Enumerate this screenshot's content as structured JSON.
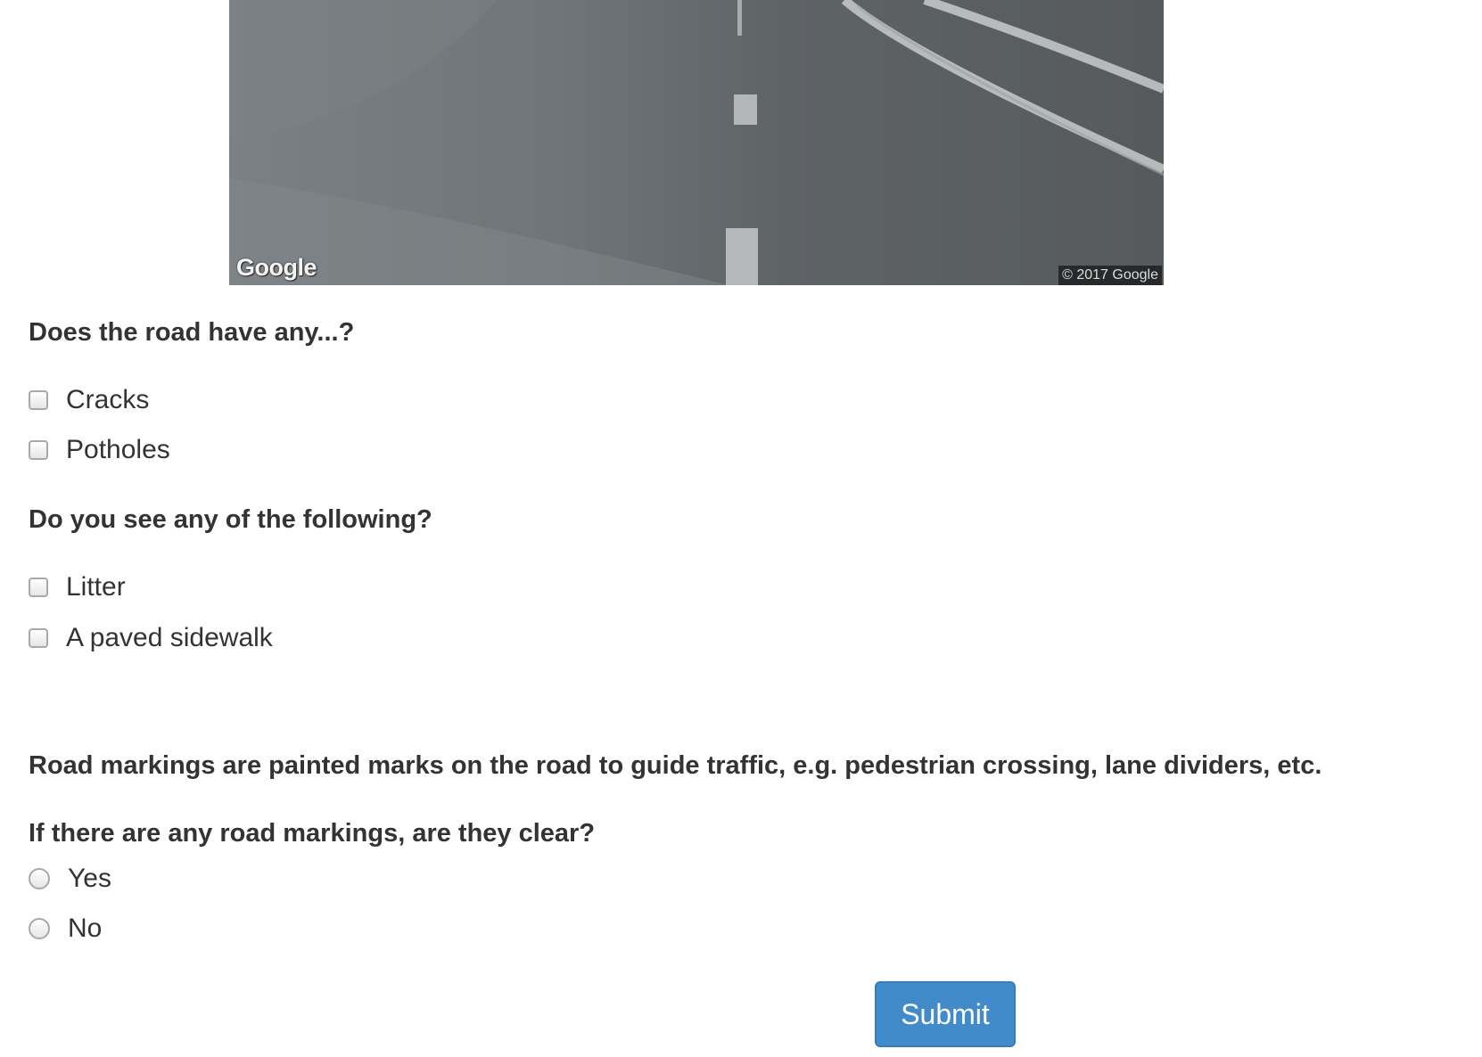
{
  "streetview": {
    "logo_text": "Google",
    "copyright": "© 2017 Google"
  },
  "section_road": {
    "question": "Does the road have any...?",
    "options": [
      "Cracks",
      "Potholes"
    ]
  },
  "section_see": {
    "question": "Do you see any of the following?",
    "options": [
      "Litter",
      "A paved sidewalk"
    ]
  },
  "markings_info": "Road markings are painted marks on the road to guide traffic, e.g. pedestrian crossing, lane dividers, etc.",
  "section_markings": {
    "question": "If there are any road markings, are they clear?",
    "options": [
      "Yes",
      "No"
    ]
  },
  "submit_label": "Submit"
}
